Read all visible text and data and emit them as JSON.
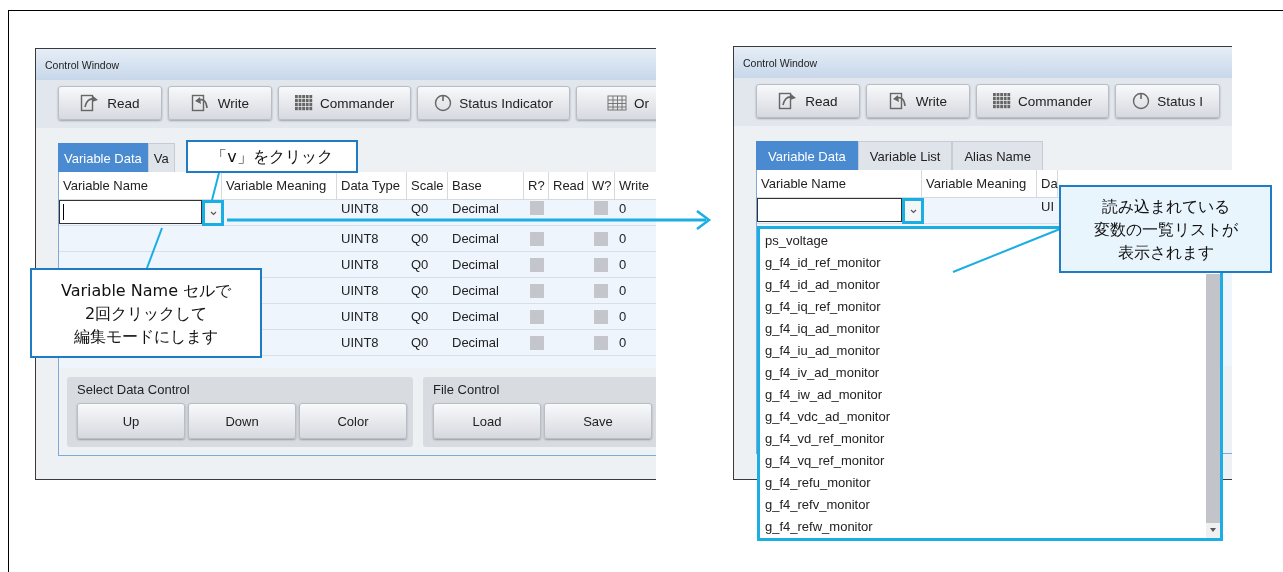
{
  "left_window": {
    "title": "Control Window",
    "toolbar": [
      {
        "label": "Read",
        "kind": "read"
      },
      {
        "label": "Write",
        "kind": "write"
      },
      {
        "label": "Commander",
        "kind": "grid"
      },
      {
        "label": "Status Indicator",
        "kind": "gauge"
      },
      {
        "label": "Or",
        "kind": "table"
      }
    ],
    "tabs": [
      {
        "label": "Variable Data",
        "selected": true
      },
      {
        "label": "Va",
        "selected": false
      }
    ],
    "table": {
      "columns": [
        "Variable Name",
        "Variable Meaning",
        "Data Type",
        "Scale",
        "Base",
        "R?",
        "Read",
        "W?",
        "Write"
      ],
      "rows": [
        {
          "cells": [
            {
              "kind": "combo",
              "editing": true
            },
            {
              "kind": "empty"
            },
            {
              "kind": "text",
              "text": "UINT8"
            },
            {
              "kind": "text",
              "text": "Q0"
            },
            {
              "kind": "text",
              "text": "Decimal"
            },
            {
              "kind": "check",
              "checked": false
            },
            {
              "kind": "empty"
            },
            {
              "kind": "check",
              "checked": false
            },
            {
              "kind": "text",
              "text": "0"
            }
          ]
        },
        {
          "cells": [
            {
              "kind": "empty"
            },
            {
              "kind": "empty"
            },
            {
              "kind": "text",
              "text": "UINT8"
            },
            {
              "kind": "text",
              "text": "Q0"
            },
            {
              "kind": "text",
              "text": "Decimal"
            },
            {
              "kind": "check",
              "checked": false
            },
            {
              "kind": "empty"
            },
            {
              "kind": "check",
              "checked": false
            },
            {
              "kind": "text",
              "text": "0"
            }
          ]
        },
        {
          "cells": [
            {
              "kind": "empty"
            },
            {
              "kind": "empty"
            },
            {
              "kind": "text",
              "text": "UINT8"
            },
            {
              "kind": "text",
              "text": "Q0"
            },
            {
              "kind": "text",
              "text": "Decimal"
            },
            {
              "kind": "check",
              "checked": false
            },
            {
              "kind": "empty"
            },
            {
              "kind": "check",
              "checked": false
            },
            {
              "kind": "text",
              "text": "0"
            }
          ]
        },
        {
          "cells": [
            {
              "kind": "empty"
            },
            {
              "kind": "empty"
            },
            {
              "kind": "text",
              "text": "UINT8"
            },
            {
              "kind": "text",
              "text": "Q0"
            },
            {
              "kind": "text",
              "text": "Decimal"
            },
            {
              "kind": "check",
              "checked": false
            },
            {
              "kind": "empty"
            },
            {
              "kind": "check",
              "checked": false
            },
            {
              "kind": "text",
              "text": "0"
            }
          ]
        },
        {
          "cells": [
            {
              "kind": "empty"
            },
            {
              "kind": "empty"
            },
            {
              "kind": "text",
              "text": "UINT8"
            },
            {
              "kind": "text",
              "text": "Q0"
            },
            {
              "kind": "text",
              "text": "Decimal"
            },
            {
              "kind": "check",
              "checked": false
            },
            {
              "kind": "empty"
            },
            {
              "kind": "check",
              "checked": false
            },
            {
              "kind": "text",
              "text": "0"
            }
          ]
        },
        {
          "cells": [
            {
              "kind": "empty"
            },
            {
              "kind": "empty"
            },
            {
              "kind": "text",
              "text": "UINT8"
            },
            {
              "kind": "text",
              "text": "Q0"
            },
            {
              "kind": "text",
              "text": "Decimal"
            },
            {
              "kind": "check",
              "checked": false
            },
            {
              "kind": "empty"
            },
            {
              "kind": "check",
              "checked": false
            },
            {
              "kind": "text",
              "text": "0"
            }
          ]
        }
      ]
    },
    "groups": [
      {
        "title": "Select Data Control",
        "buttons": [
          "Up",
          "Down",
          "Color"
        ]
      },
      {
        "title": "File Control",
        "buttons": [
          "Load",
          "Save"
        ]
      }
    ]
  },
  "right_window": {
    "title": "Control Window",
    "toolbar": [
      {
        "label": "Read",
        "kind": "read"
      },
      {
        "label": "Write",
        "kind": "write"
      },
      {
        "label": "Commander",
        "kind": "grid"
      },
      {
        "label": "Status I",
        "kind": "gauge"
      }
    ],
    "tabs": [
      {
        "label": "Variable Data",
        "selected": true
      },
      {
        "label": "Variable List",
        "selected": false
      },
      {
        "label": "Alias Name",
        "selected": false
      }
    ],
    "table": {
      "columns": [
        "Variable Name",
        "Variable Meaning",
        "Da"
      ],
      "rows": [
        {
          "cells": [
            {
              "kind": "combo",
              "editing": false
            },
            {
              "kind": "empty"
            },
            {
              "kind": "text",
              "text": "UI"
            }
          ]
        }
      ]
    },
    "dropdown": {
      "items": [
        "ps_voltage",
        "g_f4_id_ref_monitor",
        "g_f4_id_ad_monitor",
        "g_f4_iq_ref_monitor",
        "g_f4_iq_ad_monitor",
        "g_f4_iu_ad_monitor",
        "g_f4_iv_ad_monitor",
        "g_f4_iw_ad_monitor",
        "g_f4_vdc_ad_monitor",
        "g_f4_vd_ref_monitor",
        "g_f4_vq_ref_monitor",
        "g_f4_refu_monitor",
        "g_f4_refv_monitor",
        "g_f4_refw_monitor"
      ]
    }
  },
  "callouts": [
    {
      "kind": "plain",
      "lines": [
        "「v」をクリック"
      ]
    },
    {
      "kind": "plain",
      "lines": [
        "Variable Name セルで",
        "2回クリックして",
        "編集モードにします"
      ]
    },
    {
      "kind": "shaded",
      "lines": [
        "読み込まれている",
        "変数の一覧リストが",
        "表示されます"
      ]
    }
  ]
}
